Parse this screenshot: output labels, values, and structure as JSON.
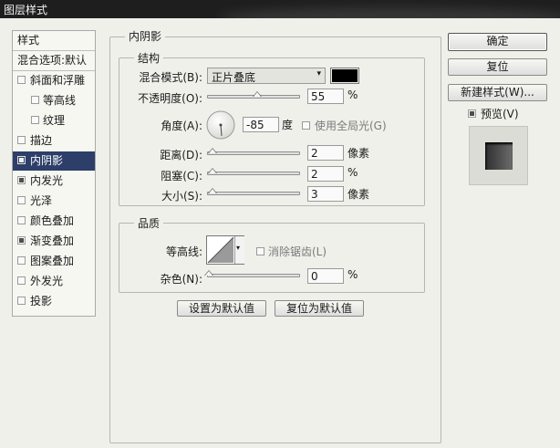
{
  "window": {
    "title": "图层样式"
  },
  "sidebar": {
    "header": "样式",
    "blend_defaults": "混合选项:默认",
    "items": [
      {
        "label": "斜面和浮雕",
        "checked": false,
        "indent": false,
        "selected": false
      },
      {
        "label": "等高线",
        "checked": false,
        "indent": true,
        "selected": false
      },
      {
        "label": "纹理",
        "checked": false,
        "indent": true,
        "selected": false
      },
      {
        "label": "描边",
        "checked": false,
        "indent": false,
        "selected": false
      },
      {
        "label": "内阴影",
        "checked": true,
        "indent": false,
        "selected": true
      },
      {
        "label": "内发光",
        "checked": true,
        "indent": false,
        "selected": false
      },
      {
        "label": "光泽",
        "checked": false,
        "indent": false,
        "selected": false
      },
      {
        "label": "颜色叠加",
        "checked": false,
        "indent": false,
        "selected": false
      },
      {
        "label": "渐变叠加",
        "checked": true,
        "indent": false,
        "selected": false
      },
      {
        "label": "图案叠加",
        "checked": false,
        "indent": false,
        "selected": false
      },
      {
        "label": "外发光",
        "checked": false,
        "indent": false,
        "selected": false
      },
      {
        "label": "投影",
        "checked": false,
        "indent": false,
        "selected": false
      }
    ]
  },
  "inner_shadow": {
    "section_title": "内阴影",
    "structure": {
      "title": "结构",
      "blend_mode_label": "混合模式(B):",
      "blend_mode_value": "正片叠底",
      "shadow_color": "#000000",
      "opacity_label": "不透明度(O):",
      "opacity_value": "55",
      "opacity_fraction": 0.55,
      "unit_percent": "%",
      "angle_label": "角度(A):",
      "angle_value": "-85",
      "angle_unit": "度",
      "global_light_label": "使用全局光(G)",
      "global_light_checked": false,
      "distance_label": "距离(D):",
      "distance_value": "2",
      "distance_unit": "像素",
      "choke_label": "阻塞(C):",
      "choke_value": "2",
      "choke_unit": "%",
      "size_label": "大小(S):",
      "size_value": "3",
      "size_unit": "像素"
    },
    "quality": {
      "title": "品质",
      "contour_label": "等高线:",
      "anti_alias_label": "消除锯齿(L)",
      "anti_alias_checked": false,
      "noise_label": "杂色(N):",
      "noise_value": "0",
      "noise_unit": "%"
    },
    "make_default_label": "设置为默认值",
    "reset_default_label": "复位为默认值"
  },
  "actions": {
    "ok_label": "确定",
    "reset_label": "复位",
    "new_style_label": "新建样式(W)...",
    "preview_label": "预览(V)",
    "preview_checked": true
  }
}
